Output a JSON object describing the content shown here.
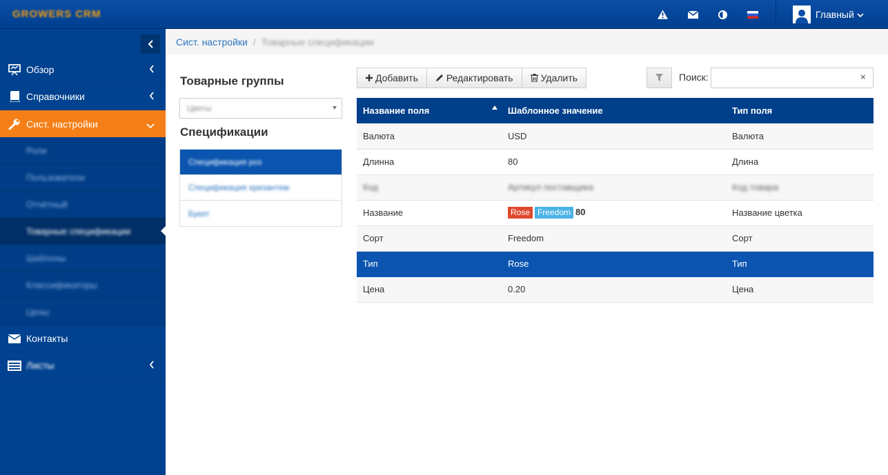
{
  "header": {
    "logo_text": "GROWERS CRM",
    "icons": [
      "warning-icon",
      "mail-icon",
      "contrast-icon",
      "flag-ru-icon"
    ],
    "user_label": "Главный"
  },
  "sidebar": {
    "items": [
      {
        "label": "Обзор",
        "icon": "presentation-icon"
      },
      {
        "label": "Справочники",
        "icon": "book-icon"
      },
      {
        "label": "Сист. настройки",
        "icon": "wrench-icon"
      },
      {
        "label": "Контакты",
        "icon": "envelope-icon"
      },
      {
        "label": "Листы",
        "icon": "list-icon"
      }
    ],
    "subitems": [
      "Роли",
      "Пользователи",
      "Отчётный",
      "Товарные спецификации",
      "Шаблоны",
      "Классификаторы",
      "Цены"
    ]
  },
  "breadcrumb": {
    "link": "Сист. настройки",
    "current": "Товарные спецификации"
  },
  "left_panel": {
    "groups_title": "Товарные группы",
    "group_selected": "Цветы",
    "specs_title": "Спецификации",
    "specs": [
      "Спецификация роз",
      "Спецификация хризантем",
      "Букет"
    ]
  },
  "toolbar": {
    "add": "Добавить",
    "edit": "Редактировать",
    "delete": "Удалить",
    "search_label": "Поиск:",
    "search_value": "",
    "search_clear": "×"
  },
  "table": {
    "headers": [
      "Название поля",
      "Шаблонное значение",
      "Тип поля"
    ],
    "rows": [
      {
        "name": "Валюта",
        "value": "USD",
        "type": "Валюта"
      },
      {
        "name": "Длинна",
        "value": "80",
        "type": "Длина"
      },
      {
        "name": "Код",
        "value": "Артикул поставщика",
        "type": "Код товара"
      },
      {
        "name": "Название",
        "tags": [
          "Rose",
          "Freedom"
        ],
        "value": "80",
        "type": "Название цветка"
      },
      {
        "name": "Сорт",
        "value": "Freedom",
        "type": "Сорт"
      },
      {
        "name": "Тип",
        "value": "Rose",
        "type": "Тип"
      },
      {
        "name": "Цена",
        "value": "0.20",
        "type": "Цена"
      }
    ]
  },
  "colors": {
    "topbar": "#003f8f",
    "sidebar": "#00428f",
    "active_nav": "#f57f17",
    "table_header": "#003f8a",
    "highlight_row": "#0b55b0",
    "tag_red": "#e0482e",
    "tag_blue": "#4ab3e6"
  }
}
